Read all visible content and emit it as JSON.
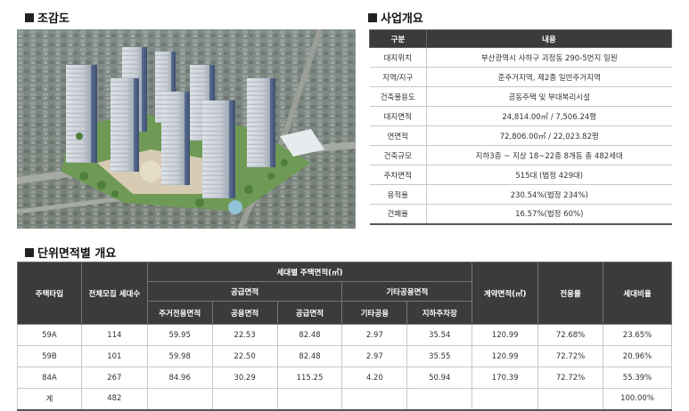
{
  "sections": {
    "bird_eye": "조감도",
    "overview": "사업개요",
    "units": "단위면적별 개요"
  },
  "overview": {
    "headers": [
      "구분",
      "내용"
    ],
    "rows": [
      {
        "label": "대지위치",
        "value": "부산광역시 사하구 괴정동 290-5번지 일원"
      },
      {
        "label": "지역/지구",
        "value": "준주거지역, 제2종 일반주거지역"
      },
      {
        "label": "건축물용도",
        "value": "공동주택 및 부대복리시설"
      },
      {
        "label": "대지면적",
        "value": "24,814.00㎡ / 7,506.24평"
      },
      {
        "label": "연면적",
        "value": "72,806.00㎡ / 22,023.82평"
      },
      {
        "label": "건축규모",
        "value": "지하3층 ~ 지상 18~22층 8개동 총 482세대"
      },
      {
        "label": "주차면적",
        "value": "515대 (법정 429대)"
      },
      {
        "label": "용적율",
        "value": "230.54%(법정 234%)"
      },
      {
        "label": "건폐율",
        "value": "16.57%(법정 60%)"
      }
    ]
  },
  "units": {
    "headers": {
      "type": "주택타입",
      "households": "전체모집 세대수",
      "area_group": "세대별 주택면적(㎡)",
      "supply_group": "공급면적",
      "other_group": "기타공용면적",
      "contract": "계약면적(㎡)",
      "efficiency": "전용률",
      "ratio": "세대비율",
      "exclusive": "주거전용면적",
      "common": "공용면적",
      "supply": "공급면적",
      "other_common": "기타공용",
      "parking": "지하주차장"
    },
    "rows": [
      {
        "type": "59A",
        "households": "114",
        "exclusive": "59.95",
        "common": "22.53",
        "supply": "82.48",
        "other_common": "2.97",
        "parking": "35.54",
        "contract": "120.99",
        "efficiency": "72.68%",
        "ratio": "23.65%"
      },
      {
        "type": "59B",
        "households": "101",
        "exclusive": "59.98",
        "common": "22.50",
        "supply": "82.48",
        "other_common": "2.97",
        "parking": "35.55",
        "contract": "120.99",
        "efficiency": "72.72%",
        "ratio": "20.96%"
      },
      {
        "type": "84A",
        "households": "267",
        "exclusive": "84.96",
        "common": "30.29",
        "supply": "115.25",
        "other_common": "4.20",
        "parking": "50.94",
        "contract": "170.39",
        "efficiency": "72.72%",
        "ratio": "55.39%"
      },
      {
        "type": "계",
        "households": "482",
        "exclusive": "",
        "common": "",
        "supply": "",
        "other_common": "",
        "parking": "",
        "contract": "",
        "efficiency": "",
        "ratio": "100.00%"
      }
    ]
  }
}
